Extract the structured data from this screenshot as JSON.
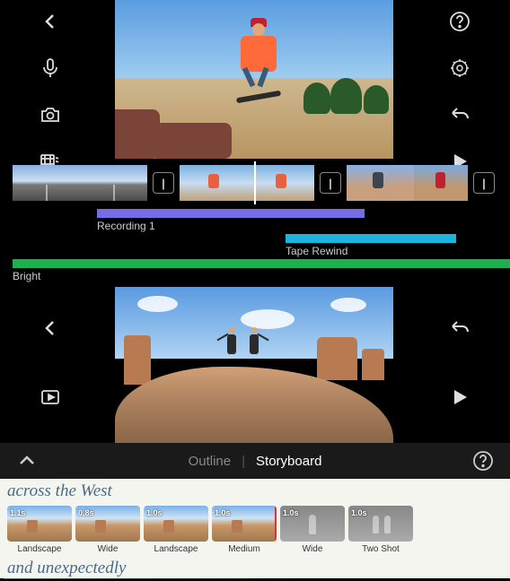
{
  "top": {
    "tracks": {
      "recording_label": "Recording 1",
      "tape_label": "Tape Rewind",
      "theme_label": "Bright"
    },
    "transition_glyph": "|"
  },
  "tabs": {
    "outline": "Outline",
    "storyboard": "Storyboard",
    "separator": "|",
    "active": "storyboard"
  },
  "storyboard": {
    "caption_1": "across the West",
    "caption_2": "and unexpectedly",
    "clips": [
      {
        "duration": "1.1s",
        "label": "Landscape",
        "kind": "desert"
      },
      {
        "duration": "0.8s",
        "label": "Wide",
        "kind": "desert"
      },
      {
        "duration": "1.0s",
        "label": "Landscape",
        "kind": "desert"
      },
      {
        "duration": "1.0s",
        "label": "Medium",
        "kind": "desert",
        "red_mark": true
      },
      {
        "duration": "1.0s",
        "label": "Wide",
        "kind": "gray-single"
      },
      {
        "duration": "1.0s",
        "label": "Two Shot",
        "kind": "gray-double"
      }
    ]
  },
  "colors": {
    "purple": "#786be8",
    "cyan": "#1cb4dc",
    "green": "#1cb050"
  }
}
